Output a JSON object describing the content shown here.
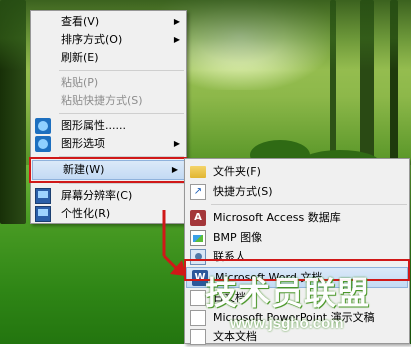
{
  "context_menu": {
    "items": [
      {
        "label": "查看(V)",
        "submenu": true
      },
      {
        "label": "排序方式(O)",
        "submenu": true
      },
      {
        "label": "刷新(E)"
      },
      {
        "label": "粘贴(P)",
        "disabled": true
      },
      {
        "label": "粘贴快捷方式(S)",
        "disabled": true
      },
      {
        "label": "图形属性......",
        "icon": "graphics-properties-icon"
      },
      {
        "label": "图形选项",
        "icon": "graphics-options-icon",
        "submenu": true
      },
      {
        "label": "新建(W)",
        "submenu": true,
        "highlighted": true
      },
      {
        "label": "屏幕分辨率(C)",
        "icon": "screen-resolution-icon"
      },
      {
        "label": "个性化(R)",
        "icon": "personalize-icon"
      }
    ]
  },
  "new_submenu": {
    "items": [
      {
        "label": "文件夹(F)",
        "icon": "folder-icon"
      },
      {
        "label": "快捷方式(S)",
        "icon": "shortcut-icon"
      },
      {
        "label": "Microsoft Access 数据库",
        "icon": "access-icon"
      },
      {
        "label": "BMP 图像",
        "icon": "bmp-image-icon"
      },
      {
        "label": "联系人",
        "icon": "contact-icon"
      },
      {
        "label": "Microsoft Word 文档",
        "icon": "word-icon",
        "highlighted": true
      },
      {
        "label": "日文档",
        "icon": "journal-document-icon"
      },
      {
        "label": "Microsoft PowerPoint 演示文稿",
        "icon": "powerpoint-icon"
      },
      {
        "label": "文本文档",
        "icon": "text-document-icon"
      }
    ]
  },
  "watermark": {
    "brand": "技术员联盟",
    "url": "www.jsgho.com"
  },
  "colors": {
    "highlight_border": "#d01818",
    "menu_bg": "#f0f0f0",
    "selection": "#c3daf4"
  }
}
